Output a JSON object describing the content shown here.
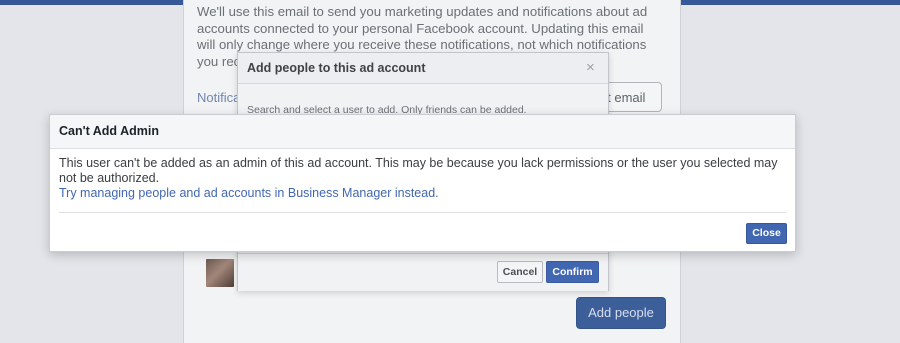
{
  "background": {
    "card_text": "We'll use this email to send you marketing updates and notifications about ad accounts connected to your personal Facebook account. Updating this email will only change where you receive these notifications, not which notifications you receive. To change your notificat",
    "notifications_link": "Notifica",
    "edit_email_label": "dit email",
    "add_people_label": "Add people"
  },
  "add_people_dialog": {
    "title": "Add people to this ad account",
    "close_glyph": "×",
    "hint": "Search and select a user to add. Only friends can be added.",
    "cancel_label": "Cancel",
    "confirm_label": "Confirm"
  },
  "modal": {
    "title": "Can't Add Admin",
    "message": "This user can't be added as an admin of this ad account. This may be because you lack permissions or the user you selected may not be authorized.",
    "link": "Try managing people and ad accounts in Business Manager instead.",
    "close_label": "Close"
  },
  "colors": {
    "brand_blue": "#4267b2",
    "top_bar": "#365899"
  }
}
